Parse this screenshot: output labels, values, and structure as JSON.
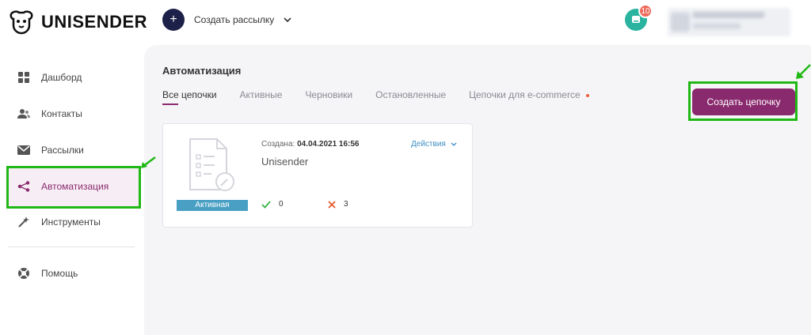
{
  "logo": {
    "text": "UNISENDER"
  },
  "header": {
    "create_mailing_label": "Создать рассылку",
    "notification_count": "10"
  },
  "sidebar": {
    "items": [
      {
        "label": "Дашборд",
        "icon": "dashboard-icon"
      },
      {
        "label": "Контакты",
        "icon": "contacts-icon"
      },
      {
        "label": "Рассылки",
        "icon": "mail-icon"
      },
      {
        "label": "Автоматизация",
        "icon": "automation-icon",
        "active": true
      },
      {
        "label": "Инструменты",
        "icon": "tools-icon"
      }
    ],
    "help_label": "Помощь"
  },
  "main": {
    "title": "Автоматизация",
    "tabs": [
      {
        "label": "Все цепочки",
        "active": true
      },
      {
        "label": "Активные"
      },
      {
        "label": "Черновики"
      },
      {
        "label": "Остановленные"
      },
      {
        "label": "Цепочки для e-commerce"
      }
    ],
    "create_chain_label": "Создать цепочку",
    "chain_card": {
      "created_label": "Создана:",
      "created_value": "04.04.2021 16:56",
      "actions_label": "Действия",
      "name": "Unisender",
      "status": "Активная",
      "success_count": "0",
      "error_count": "3"
    }
  },
  "colors": {
    "brand": "#8a2a6e",
    "status_active": "#4aa0c4",
    "annotation": "#1fb814",
    "success": "#3bb34a",
    "error": "#e8592e"
  }
}
